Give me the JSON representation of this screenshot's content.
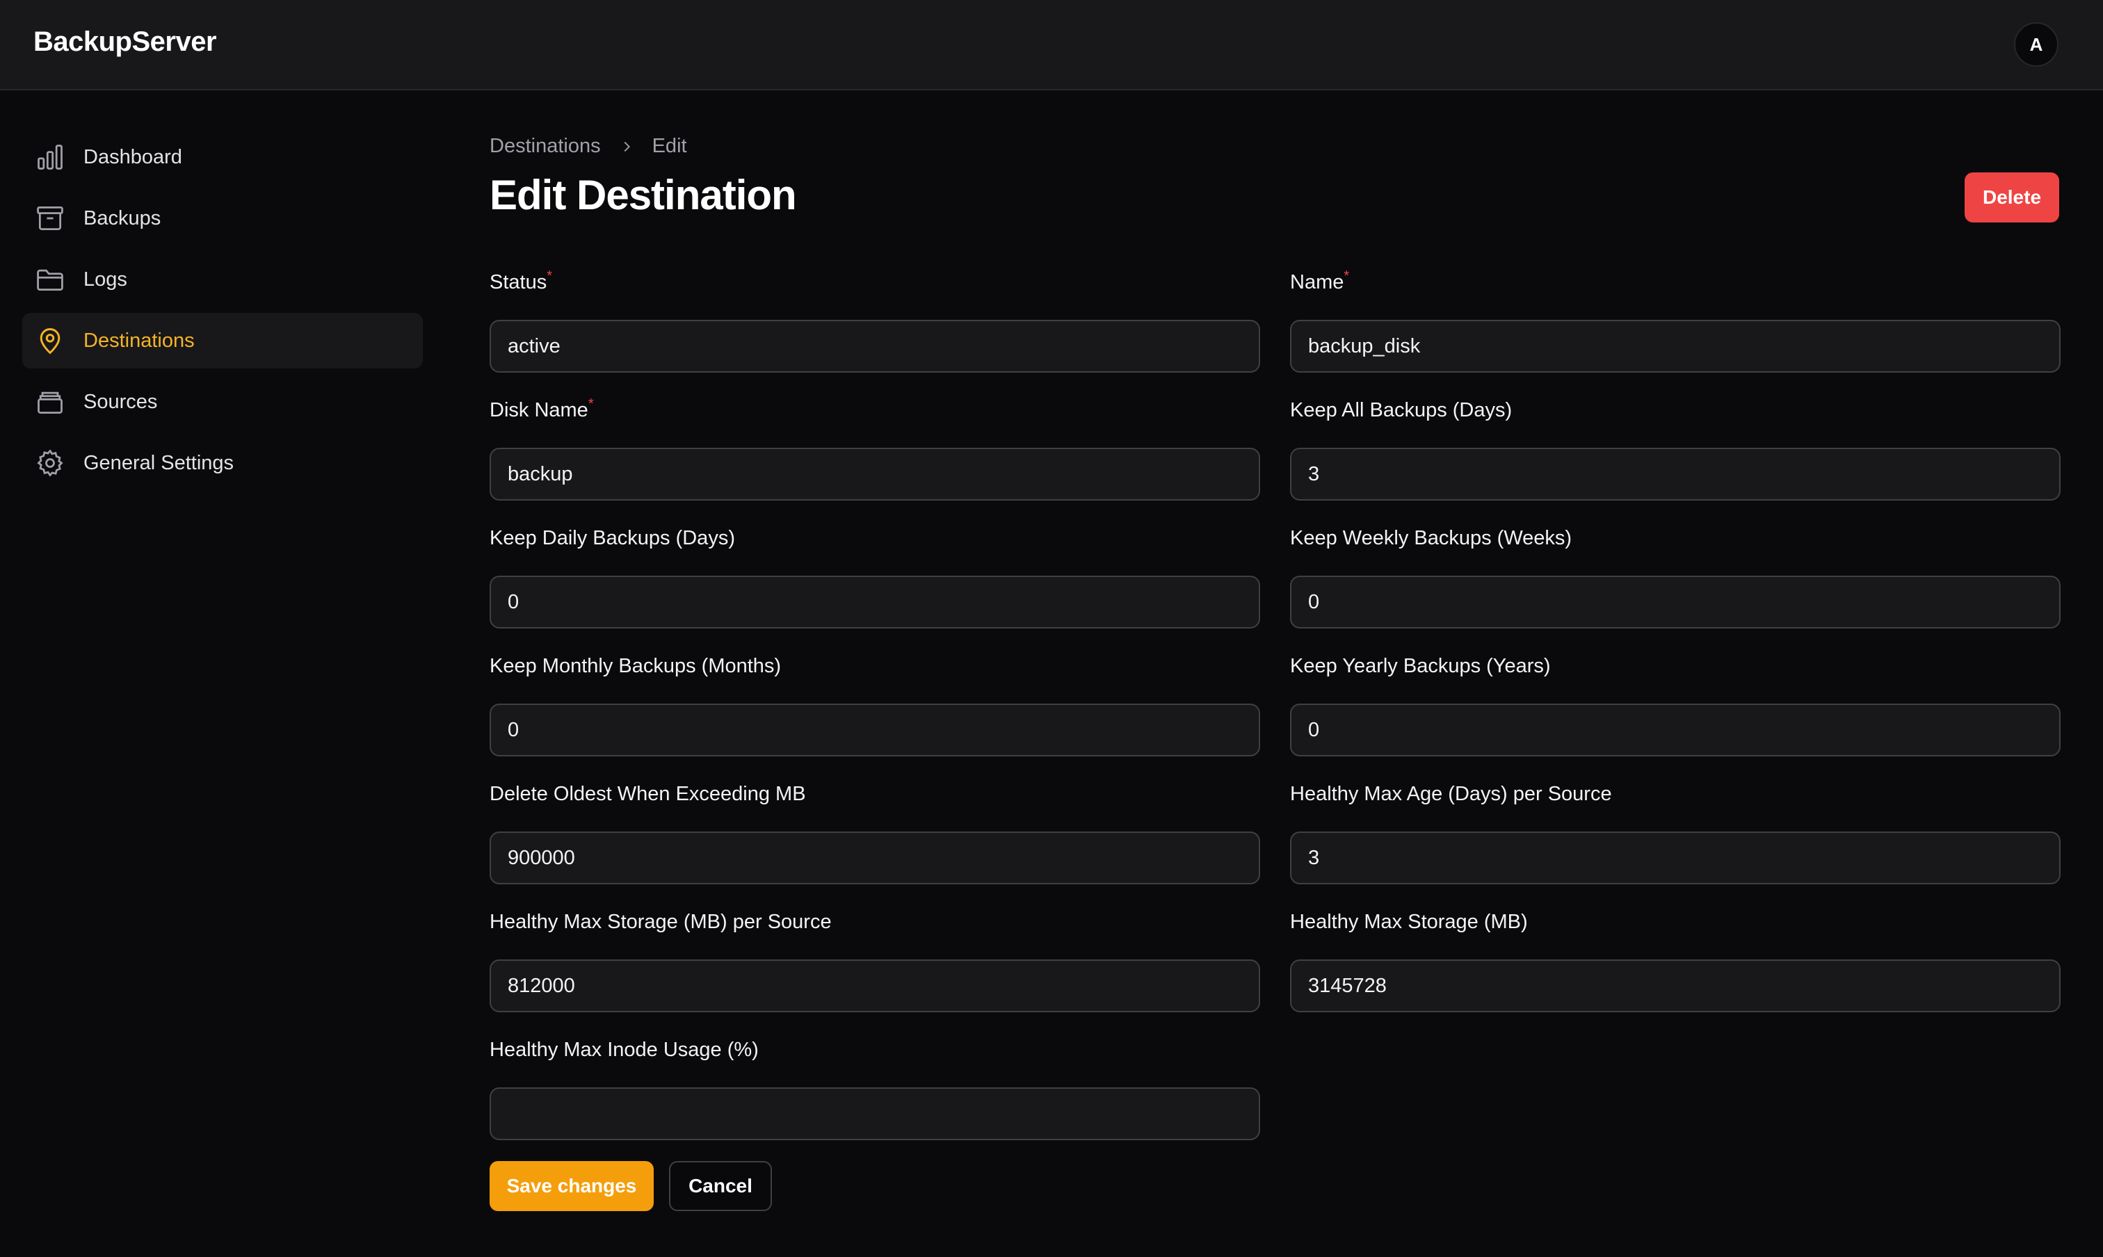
{
  "app": {
    "brand": "BackupServer",
    "avatar_initial": "A"
  },
  "sidebar": {
    "items": [
      {
        "label": "Dashboard",
        "icon": "bar-chart-icon"
      },
      {
        "label": "Backups",
        "icon": "archive-box-icon"
      },
      {
        "label": "Logs",
        "icon": "folder-icon"
      },
      {
        "label": "Destinations",
        "icon": "map-pin-icon",
        "active": true
      },
      {
        "label": "Sources",
        "icon": "stack-icon"
      },
      {
        "label": "General Settings",
        "icon": "gear-icon"
      }
    ]
  },
  "breadcrumb": {
    "parent": "Destinations",
    "current": "Edit"
  },
  "page": {
    "title": "Edit Destination",
    "delete_label": "Delete"
  },
  "form": {
    "status": {
      "label": "Status",
      "required": "*",
      "value": "active"
    },
    "name": {
      "label": "Name",
      "required": "*",
      "value": "backup_disk"
    },
    "disk_name": {
      "label": "Disk Name",
      "required": "*",
      "value": "backup"
    },
    "keep_all": {
      "label": "Keep All Backups (Days)",
      "value": "3"
    },
    "keep_daily": {
      "label": "Keep Daily Backups (Days)",
      "value": "0"
    },
    "keep_weekly": {
      "label": "Keep Weekly Backups (Weeks)",
      "value": "0"
    },
    "keep_monthly": {
      "label": "Keep Monthly Backups (Months)",
      "value": "0"
    },
    "keep_yearly": {
      "label": "Keep Yearly Backups (Years)",
      "value": "0"
    },
    "delete_oldest": {
      "label": "Delete Oldest When Exceeding MB",
      "value": "900000"
    },
    "healthy_age": {
      "label": "Healthy Max Age (Days) per Source",
      "value": "3"
    },
    "healthy_storage_source": {
      "label": "Healthy Max Storage (MB) per Source",
      "value": "812000"
    },
    "healthy_storage": {
      "label": "Healthy Max Storage (MB)",
      "value": "3145728"
    },
    "healthy_inode": {
      "label": "Healthy Max Inode Usage (%)",
      "value": ""
    },
    "save_label": "Save changes",
    "cancel_label": "Cancel"
  },
  "colors": {
    "accent": "#f59e0b",
    "danger": "#ef4444",
    "active_nav": "#f5b326"
  }
}
